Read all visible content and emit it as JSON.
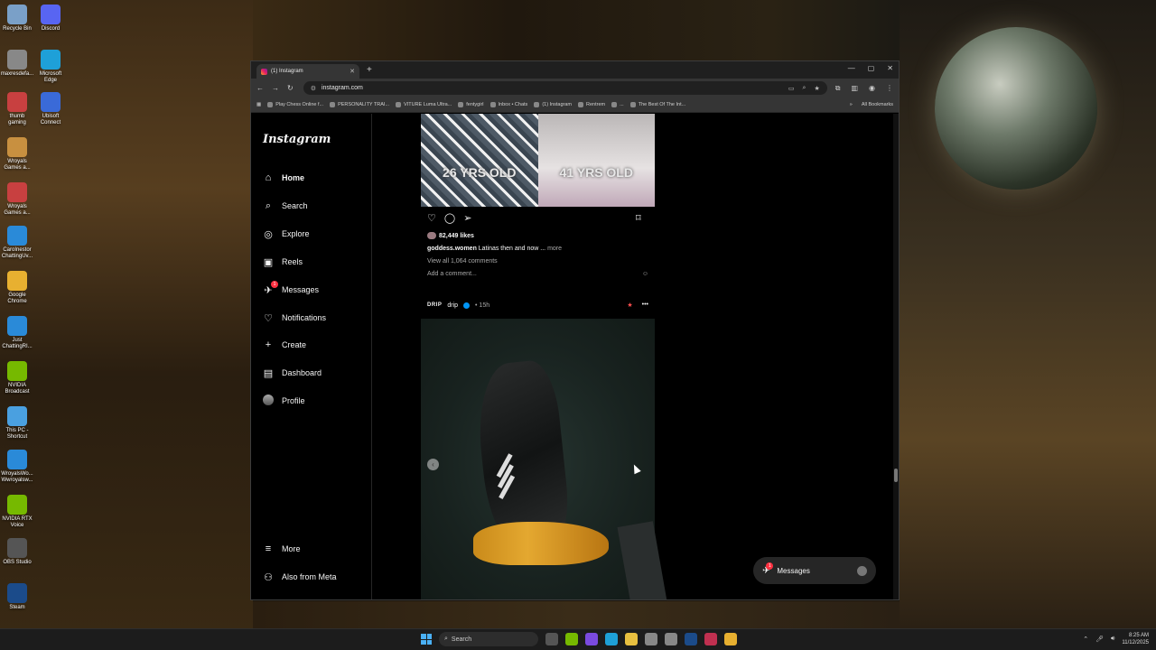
{
  "desktop": {
    "icons": [
      {
        "label": "Recycle Bin",
        "color": "#7aa0c8"
      },
      {
        "label": "Discord",
        "color": "#5865f2"
      },
      {
        "label": "maxresdefa...",
        "color": "#888888"
      },
      {
        "label": "Microsoft Edge",
        "color": "#1ea0d8"
      },
      {
        "label": "thumb gaming",
        "color": "#c84040"
      },
      {
        "label": "Ubisoft Connect",
        "color": "#3a6ad8"
      },
      {
        "label": "Wroyals Games a...",
        "color": "#c89040"
      },
      {
        "label": "Wroyals Games a...",
        "color": "#c84040"
      },
      {
        "label": "CaroInestor ChattingUv...",
        "color": "#2a8ad8"
      },
      {
        "label": "Google Chrome",
        "color": "#e8b030"
      },
      {
        "label": "Just ChattingRI...",
        "color": "#2a8ad8"
      },
      {
        "label": "NVIDIA Broadcast",
        "color": "#76b900"
      },
      {
        "label": "This PC - Shortcut",
        "color": "#4aa0e0"
      },
      {
        "label": "WroyalsWo... Wwroyalsw...",
        "color": "#2a8ad8"
      },
      {
        "label": "NVIDIA RTX Voice",
        "color": "#76b900"
      },
      {
        "label": "OBS Studio",
        "color": "#555555"
      },
      {
        "label": "Steam",
        "color": "#1b4b8a"
      }
    ]
  },
  "browser": {
    "tab_title": "(1) Instagram",
    "url": "instagram.com",
    "bookmarks": [
      "Play Chess Online f...",
      "PERSONALITY TRAI...",
      "VITURE Luma Ultra...",
      "fentygirl",
      "Inbox • Chats",
      "(1) Instagram",
      "Rentrem",
      "...",
      "The Best Of The Int..."
    ],
    "all_bookmarks": "All Bookmarks"
  },
  "instagram": {
    "logo": "Instagram",
    "nav": [
      {
        "label": "Home",
        "icon": "home-icon",
        "glyph": "⌂"
      },
      {
        "label": "Search",
        "icon": "search-icon",
        "glyph": "⌕"
      },
      {
        "label": "Explore",
        "icon": "explore-icon",
        "glyph": "◎"
      },
      {
        "label": "Reels",
        "icon": "reels-icon",
        "glyph": "▣"
      },
      {
        "label": "Messages",
        "icon": "messages-icon",
        "glyph": "✈",
        "badge": "1"
      },
      {
        "label": "Notifications",
        "icon": "heart-icon",
        "glyph": "♡"
      },
      {
        "label": "Create",
        "icon": "plus-icon",
        "glyph": "+"
      },
      {
        "label": "Dashboard",
        "icon": "dashboard-icon",
        "glyph": "▤"
      },
      {
        "label": "Profile",
        "icon": "avatar",
        "glyph": ""
      }
    ],
    "bottom_nav": [
      {
        "label": "More",
        "icon": "menu-icon",
        "glyph": "≡"
      },
      {
        "label": "Also from Meta",
        "icon": "meta-icon",
        "glyph": "⚇"
      }
    ],
    "post1": {
      "left_overlay": "26 YRS OLD",
      "right_overlay": "41 YRS OLD",
      "likes": "82,449 likes",
      "caption_user": "goddess.women",
      "caption_text": " Latinas then and now ... ",
      "caption_more": "more",
      "view_comments": "View all 1,064 comments",
      "add_comment": "Add a comment..."
    },
    "post2": {
      "account_logo": "DRIP",
      "username": "drip",
      "time": "• 15h"
    },
    "messages_pill": {
      "label": "Messages",
      "badge": "1"
    }
  },
  "taskbar": {
    "search": "Search",
    "time": "8:25 AM",
    "date": "11/12/2025"
  }
}
